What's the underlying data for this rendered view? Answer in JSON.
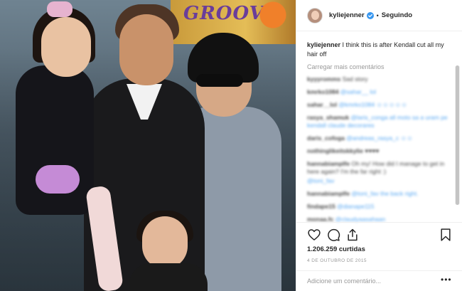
{
  "header": {
    "username": "kyliejenner",
    "separator": "•",
    "follow_state": "Seguindo"
  },
  "caption": {
    "username": "kyliejenner",
    "text": "I think this is after Kendall cut all my hair off"
  },
  "load_more": "Carregar mais comentários",
  "comments": [
    {
      "user": "kyyyromms",
      "text": "Sad story"
    },
    {
      "user": "kmrko1084",
      "text": "@sahar__ lol"
    },
    {
      "user": "sahar__lol",
      "text": "@kmrko1084 ☺☺☺☺☺"
    },
    {
      "user": "rasya_shamuk",
      "text": "@laris_conga all moto sa a uram pe kendall claude decorares"
    },
    {
      "user": "daris_cofoga",
      "text": "@andreas_rasya_c ☺☺"
    },
    {
      "user": "nothinglikeitskkylie",
      "text": "♥♥♥♥"
    },
    {
      "user": "hannabiamplfe",
      "text": "Oh my! How did I manage to get in here again? I'm the far right :)"
    },
    {
      "user": "",
      "text": "@toni_fav"
    },
    {
      "user": "hannabiamplfe",
      "text": "@toni_fav the back right."
    },
    {
      "user": "findape15",
      "text": "@dianape115"
    },
    {
      "user": "monaa.fc",
      "text": "@claudyaasahaan"
    }
  ],
  "likes": "1.206.259 curtidas",
  "date": "4 de outubro de 2015",
  "add_comment": {
    "placeholder": "Adicione um comentário..."
  },
  "icons": {
    "like": "heart-icon",
    "comment": "comment-icon",
    "share": "share-icon",
    "save": "bookmark-icon",
    "verified": "verified-badge-icon",
    "more": "more-options-icon"
  },
  "colors": {
    "link_blue": "#3897f0",
    "text": "#262626",
    "muted": "#999999",
    "border": "#efefef"
  }
}
